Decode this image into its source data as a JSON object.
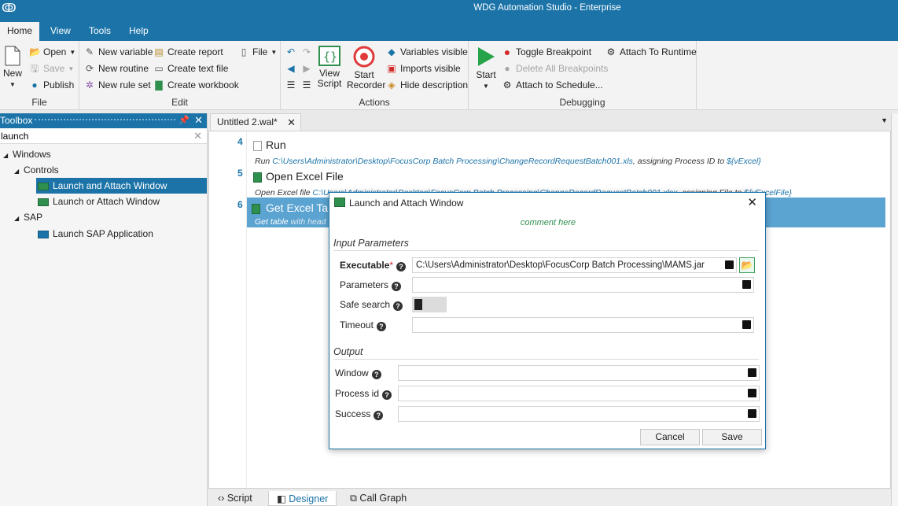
{
  "app": {
    "title": "WDG Automation Studio - Enterprise"
  },
  "menu": [
    "Home",
    "View",
    "Tools",
    "Help"
  ],
  "ribbon": {
    "file_group": {
      "new": "New",
      "open": "Open",
      "save": "Save",
      "publish": "Publish",
      "label": "File"
    },
    "edit_group": {
      "new_variable": "New variable",
      "new_routine": "New routine",
      "new_rule_set": "New rule set",
      "create_report": "Create report",
      "create_text_file": "Create text file",
      "create_workbook": "Create workbook",
      "file": "File",
      "label": "Edit"
    },
    "actions_group": {
      "view_script_1": "View",
      "view_script_2": "Script",
      "start_recorder_1": "Start",
      "start_recorder_2": "Recorder",
      "variables_visible": "Variables visible",
      "imports_visible": "Imports visible",
      "hide_description": "Hide description",
      "label": "Actions"
    },
    "debugging_group": {
      "start": "Start",
      "toggle_breakpoint": "Toggle Breakpoint",
      "delete_all_breakpoints": "Delete All Breakpoints",
      "attach_to_schedule": "Attach to Schedule...",
      "attach_to_runtime": "Attach To Runtime",
      "label": "Debugging"
    }
  },
  "toolbox": {
    "title": "Toolbox",
    "search_value": "launch",
    "tree": {
      "windows": "Windows",
      "controls": "Controls",
      "launch_attach": "Launch and Attach Window",
      "launch_or_attach": "Launch or Attach Window",
      "sap": "SAP",
      "launch_sap": "Launch SAP Application"
    }
  },
  "editor": {
    "tab_title": "Untitled 2.wal*",
    "steps": [
      {
        "num": "4",
        "name": "Run",
        "desc_prefix": "Run ",
        "desc_path": "C:\\Users\\Administrator\\Desktop\\FocusCorp Batch Processing\\ChangeRecordRequestBatch001.xls",
        "desc_mid": ", assigning Process ID to ",
        "desc_var": "${vExcel}"
      },
      {
        "num": "5",
        "name": "Open Excel File",
        "desc_prefix": "Open Excel file ",
        "desc_path": "C:\\Users\\Administrator\\Desktop\\FocusCorp Batch Processing\\ChangeRecordRequestBatch001.xlsx",
        "desc_mid": ", assigning File to ",
        "desc_var": "${vExcelFile}"
      },
      {
        "num": "6",
        "name": "Get Excel Tal",
        "desc_prefix": "Get table",
        "desc_path": "",
        "desc_mid": " with head",
        "desc_var": ""
      }
    ],
    "bottom_tabs": [
      "Script",
      "Designer",
      "Call Graph"
    ]
  },
  "dialog": {
    "title": "Launch and Attach Window",
    "comment": "comment here",
    "input_section": "Input Parameters",
    "executable_label": "Executable",
    "executable_value": "C:\\Users\\Administrator\\Desktop\\FocusCorp Batch Processing\\MAMS.jar",
    "parameters_label": "Parameters",
    "safe_search_label": "Safe search",
    "timeout_label": "Timeout",
    "output_section": "Output",
    "window_label": "Window",
    "process_id_label": "Process id",
    "success_label": "Success",
    "cancel": "Cancel",
    "save": "Save"
  }
}
